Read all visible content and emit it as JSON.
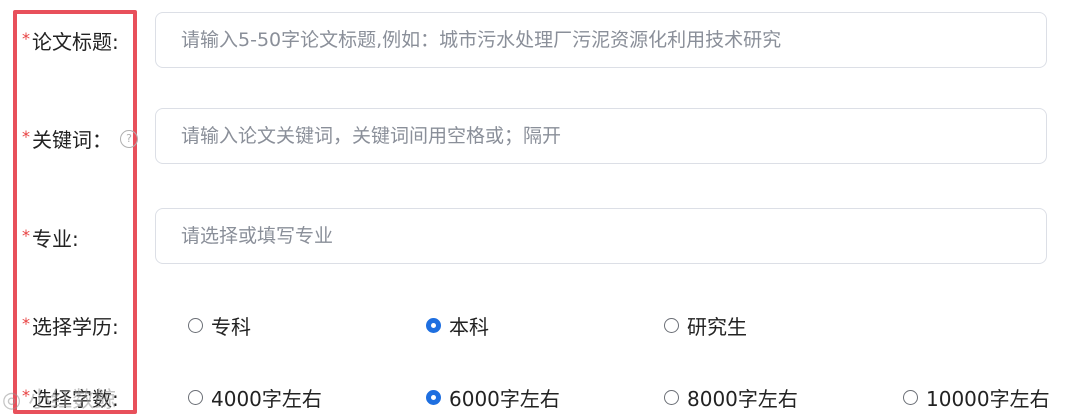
{
  "form": {
    "title": {
      "label": "论文标题:",
      "placeholder": "请输入5-50字论文标题,例如：城市污水处理厂污泥资源化利用技术研究"
    },
    "keywords": {
      "label": "关键词：",
      "help": "?",
      "placeholder": "请输入论文关键词，关键词间用空格或；隔开"
    },
    "major": {
      "label": "专业:",
      "placeholder": "请选择或填写专业"
    },
    "education": {
      "label": "选择学历:",
      "options": [
        "专科",
        "本科",
        "研究生"
      ],
      "selected": "本科"
    },
    "wordcount": {
      "label": "选择字数:",
      "options": [
        "4000字左右",
        "6000字左右",
        "8000字左右",
        "10000字左右"
      ],
      "selected": "6000字左右"
    },
    "required_mark": "*"
  },
  "watermark": "◎ 小红数鲸",
  "colors": {
    "highlight": "#e8505b",
    "required": "#e84040",
    "radio_selected": "#1e6fe0"
  }
}
